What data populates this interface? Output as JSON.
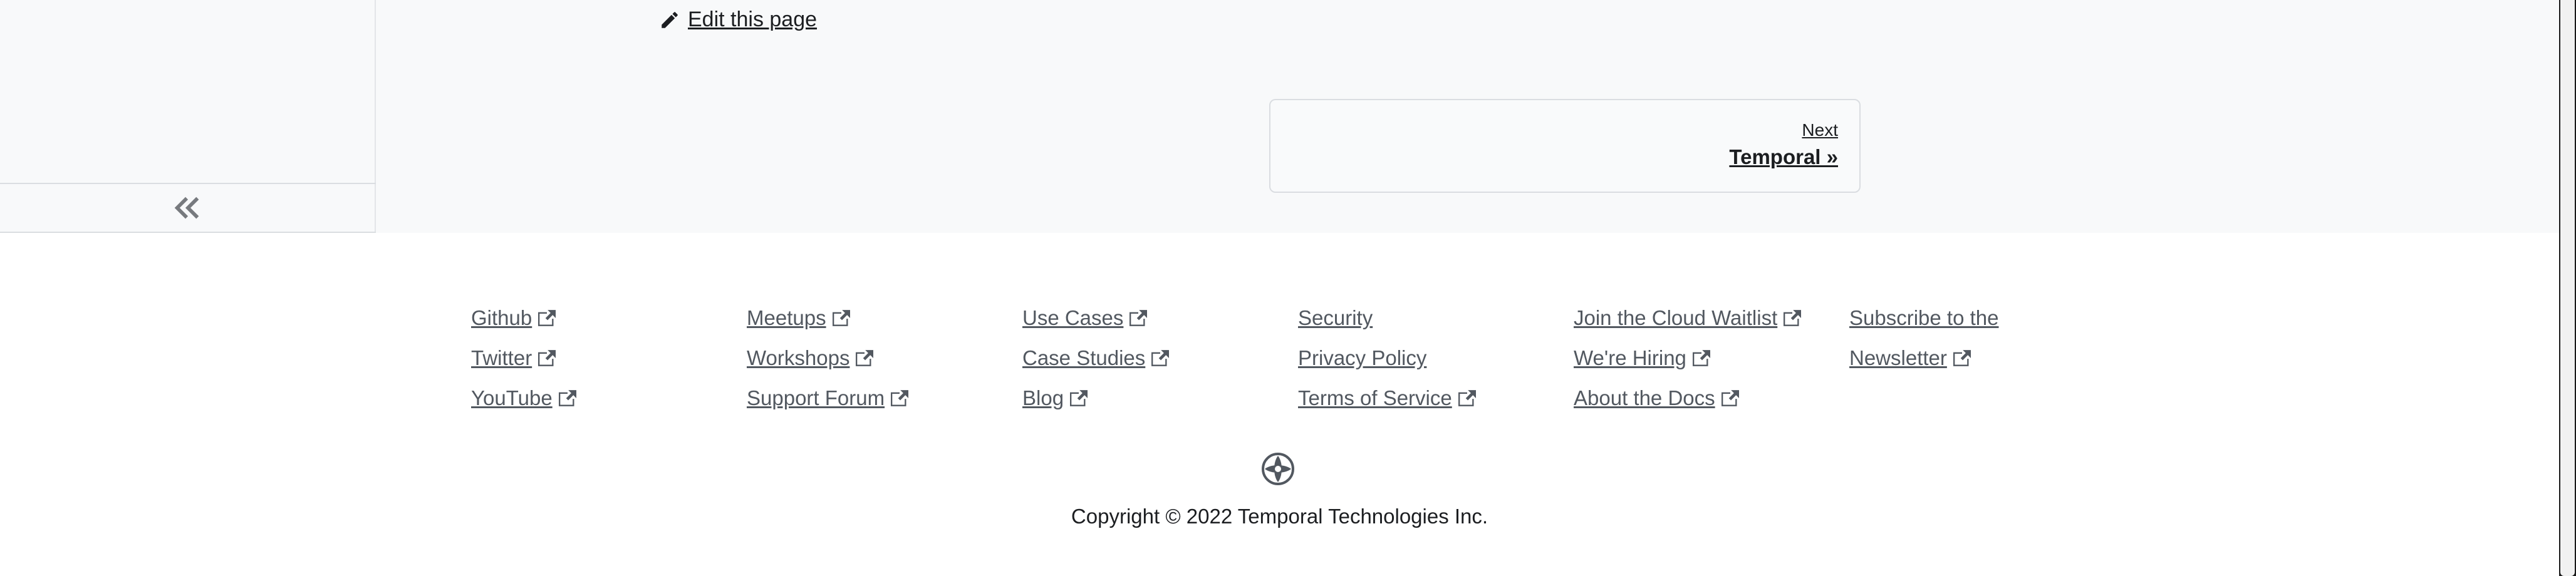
{
  "docs": {
    "edit_link": "Edit this page",
    "pagination": {
      "sublabel": "Next",
      "label": "Temporal »"
    },
    "collapse_icon": "double-chevron-left-icon"
  },
  "footer": {
    "columns": [
      {
        "links": [
          "Github",
          "Twitter",
          "YouTube"
        ]
      },
      {
        "links": [
          "Meetups",
          "Workshops",
          "Support Forum"
        ]
      },
      {
        "links": [
          "Use Cases",
          "Case Studies",
          "Blog"
        ]
      },
      {
        "links": [
          "Security",
          "Privacy Policy",
          "Terms of Service"
        ]
      },
      {
        "links": [
          "Join the Cloud Waitlist",
          "We're Hiring",
          "About the Docs"
        ]
      },
      {
        "links": [
          "Subscribe to the",
          "Newsletter"
        ]
      }
    ],
    "logo_icon": "temporal-logo-icon",
    "copyright": "Copyright © 2022 Temporal Technologies Inc."
  },
  "colors": {
    "docs_background": "#f8f9fa",
    "link_gray": "#525860",
    "text_dark": "#1c1e21",
    "border": "#dadde1"
  }
}
